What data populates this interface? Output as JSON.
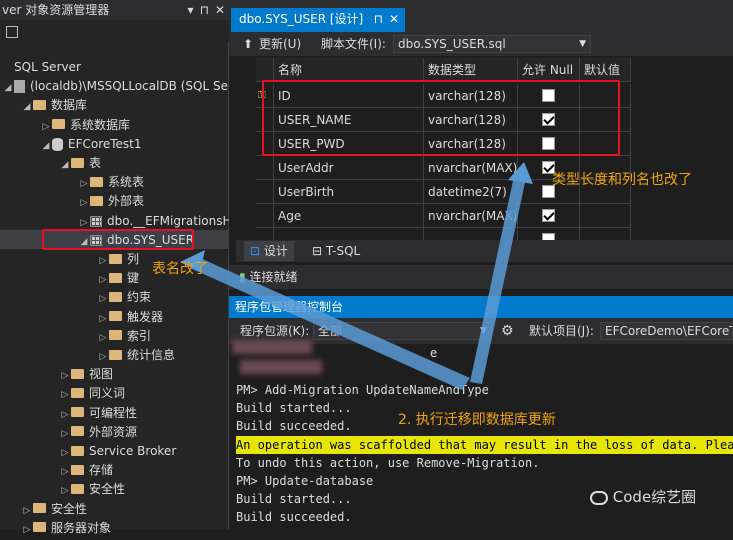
{
  "explorer": {
    "title": "ver 对象资源管理器",
    "title_buttons": [
      "▾",
      "⊓",
      "✕"
    ],
    "tree": [
      {
        "label": "SQL Server",
        "indent": 0,
        "icon": "none",
        "arrow": ""
      },
      {
        "label": "(localdb)\\MSSQLLocalDB (SQL Serv",
        "indent": 0,
        "icon": "server-icon",
        "arrow": "◢"
      },
      {
        "label": "数据库",
        "indent": 1,
        "icon": "folder-icon",
        "arrow": "◢"
      },
      {
        "label": "系统数据库",
        "indent": 2,
        "icon": "folder-icon",
        "arrow": "▷"
      },
      {
        "label": "EFCoreTest1",
        "indent": 2,
        "icon": "database-icon",
        "arrow": "◢"
      },
      {
        "label": "表",
        "indent": 3,
        "icon": "folder-icon",
        "arrow": "◢"
      },
      {
        "label": "系统表",
        "indent": 4,
        "icon": "folder-icon",
        "arrow": "▷"
      },
      {
        "label": "外部表",
        "indent": 4,
        "icon": "folder-icon",
        "arrow": "▷"
      },
      {
        "label": "dbo.__EFMigrationsHis",
        "indent": 4,
        "icon": "table-icon",
        "arrow": "▷"
      },
      {
        "label": "dbo.SYS_USER",
        "indent": 4,
        "icon": "table-icon",
        "arrow": "◢"
      },
      {
        "label": "列",
        "indent": 5,
        "icon": "folder-icon",
        "arrow": "▷"
      },
      {
        "label": "键",
        "indent": 5,
        "icon": "folder-icon",
        "arrow": "▷"
      },
      {
        "label": "约束",
        "indent": 5,
        "icon": "folder-icon",
        "arrow": "▷"
      },
      {
        "label": "触发器",
        "indent": 5,
        "icon": "folder-icon",
        "arrow": "▷"
      },
      {
        "label": "索引",
        "indent": 5,
        "icon": "folder-icon",
        "arrow": "▷"
      },
      {
        "label": "统计信息",
        "indent": 5,
        "icon": "folder-icon",
        "arrow": "▷"
      },
      {
        "label": "视图",
        "indent": 3,
        "icon": "folder-icon",
        "arrow": "▷"
      },
      {
        "label": "同义词",
        "indent": 3,
        "icon": "folder-icon",
        "arrow": "▷"
      },
      {
        "label": "可编程性",
        "indent": 3,
        "icon": "folder-icon",
        "arrow": "▷"
      },
      {
        "label": "外部资源",
        "indent": 3,
        "icon": "folder-icon",
        "arrow": "▷"
      },
      {
        "label": "Service Broker",
        "indent": 3,
        "icon": "folder-icon",
        "arrow": "▷"
      },
      {
        "label": "存储",
        "indent": 3,
        "icon": "folder-icon",
        "arrow": "▷"
      },
      {
        "label": "安全性",
        "indent": 3,
        "icon": "folder-icon",
        "arrow": "▷"
      },
      {
        "label": "安全性",
        "indent": 1,
        "icon": "folder-icon",
        "arrow": "▷"
      },
      {
        "label": "服务器对象",
        "indent": 1,
        "icon": "folder-icon",
        "arrow": "▷"
      }
    ]
  },
  "designer": {
    "tab_title": "dbo.SYS_USER [设计]",
    "tab_pin": "⊓",
    "tab_close": "✕",
    "toolbar": {
      "refresh": "更新(U)",
      "script_label": "脚本文件(I):",
      "script_value": "dbo.SYS_USER.sql"
    },
    "grid_headers": [
      "名称",
      "数据类型",
      "允许 Null",
      "默认值"
    ],
    "rows": [
      {
        "key": "⚿",
        "name": "ID",
        "type": "varchar(128)",
        "nullable": false
      },
      {
        "key": "",
        "name": "USER_NAME",
        "type": "varchar(128)",
        "nullable": true
      },
      {
        "key": "",
        "name": "USER_PWD",
        "type": "varchar(128)",
        "nullable": false
      },
      {
        "key": "",
        "name": "UserAddr",
        "type": "nvarchar(MAX)",
        "nullable": true
      },
      {
        "key": "",
        "name": "UserBirth",
        "type": "datetime2(7)",
        "nullable": false
      },
      {
        "key": "",
        "name": "Age",
        "type": "nvarchar(MAX)",
        "nullable": true
      },
      {
        "key": "",
        "name": "",
        "type": "",
        "nullable": false
      }
    ],
    "bottom_tabs": {
      "design": "设计",
      "tsql": "T-SQL"
    },
    "status": "连接就绪"
  },
  "console": {
    "header": "程序包管理器控制台",
    "source_label": "程序包源(K):",
    "source_value": "全部",
    "default_project_label": "默认项目(J):",
    "default_project_value": "EFCoreDemo\\EFCoreT",
    "lines": [
      {
        "text": "PM> Add-Migration UpdateNameAndType",
        "warn": false
      },
      {
        "text": "Build started...",
        "warn": false
      },
      {
        "text": "Build succeeded.",
        "warn": false
      },
      {
        "text": "An operation was scaffolded that may result in the loss of data. Plea",
        "warn": true
      },
      {
        "text": "To undo this action, use Remove-Migration.",
        "warn": false
      },
      {
        "text": "PM> Update-database",
        "warn": false
      },
      {
        "text": "Build started...",
        "warn": false
      },
      {
        "text": "Build succeeded.",
        "warn": false
      }
    ],
    "partial_text": "e"
  },
  "annotations": {
    "table_renamed": "表名改了",
    "type_changed": "类型长度和列名也改了",
    "migrate": "2. 执行迁移即数据库更新",
    "watermark": "Code综艺圈"
  },
  "colors": {
    "accent": "#007acc",
    "annotation_red": "#e81123",
    "annotation_orange": "#f0a30a",
    "arrow_blue": "#5b9bd5",
    "warning_bg": "#e6e600"
  }
}
